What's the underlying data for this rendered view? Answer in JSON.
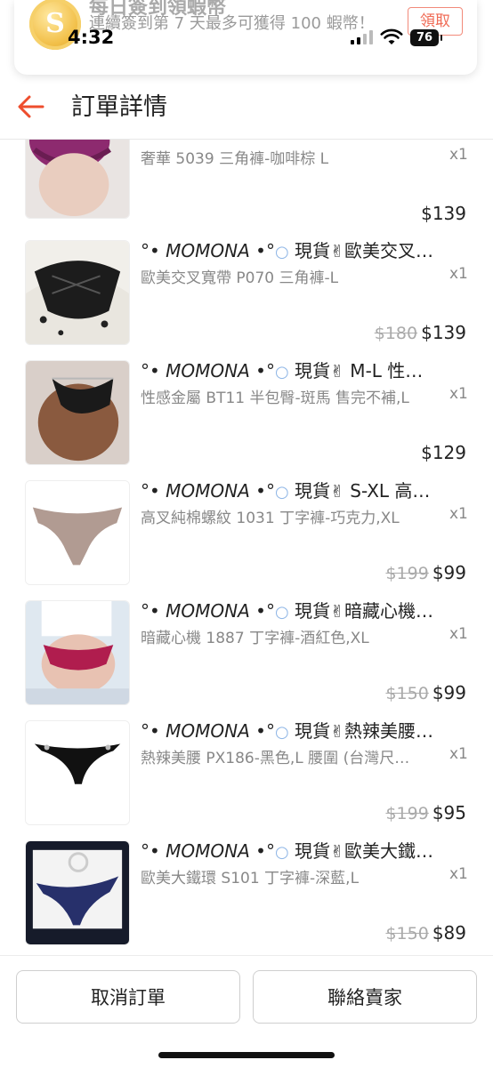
{
  "status_bar": {
    "time": "4:32",
    "battery": "76"
  },
  "banner": {
    "title": "每日簽到領蝦幣",
    "text": "連續簽到第 7 天最多可獲得 100 蝦幣！",
    "claim_label": "領取",
    "coin_letter": "S"
  },
  "header": {
    "title": "訂單詳情"
  },
  "items": [
    {
      "title": "",
      "variant": "奢華 5039 三角褲-咖啡棕 L",
      "qty": "x1",
      "orig_price": "",
      "price": "$139"
    },
    {
      "title_prefix": "°•",
      "brand": "MOMONA",
      "title_mid": "•°",
      "title_tail": "現貨",
      "title_end": "歐美交叉…",
      "variant": "歐美交叉寬帶 P070 三角褲-L",
      "qty": "x1",
      "orig_price": "$180",
      "price": "$139"
    },
    {
      "title_prefix": "°•",
      "brand": "MOMONA",
      "title_mid": "•°",
      "title_tail": "現貨",
      "title_end": " M-L 性…",
      "variant": "性感金屬 BT11 半包臀-斑馬 售完不補,L",
      "qty": "x1",
      "orig_price": "",
      "price": "$129"
    },
    {
      "title_prefix": "°•",
      "brand": "MOMONA",
      "title_mid": "•°",
      "title_tail": "現貨",
      "title_end": " S-XL 高…",
      "variant": "高叉純棉螺紋 1031 丁字褲-巧克力,XL",
      "qty": "x1",
      "orig_price": "$199",
      "price": "$99"
    },
    {
      "title_prefix": "°•",
      "brand": "MOMONA",
      "title_mid": "•°",
      "title_tail": "現貨",
      "title_end": "暗藏心機…",
      "variant": "暗藏心機 1887 丁字褲-酒紅色,XL",
      "qty": "x1",
      "orig_price": "$150",
      "price": "$99"
    },
    {
      "title_prefix": "°•",
      "brand": "MOMONA",
      "title_mid": "•°",
      "title_tail": "現貨",
      "title_end": "熱辣美腰…",
      "variant": "熱辣美腰 PX186-黑色,L 腰圍 (台灣尺…",
      "qty": "x1",
      "orig_price": "$199",
      "price": "$95"
    },
    {
      "title_prefix": "°•",
      "brand": "MOMONA",
      "title_mid": "•°",
      "title_tail": "現貨",
      "title_end": "歐美大鐵…",
      "variant": "歐美大鐵環 S101 丁字褲-深藍,L",
      "qty": "x1",
      "orig_price": "$150",
      "price": "$89"
    }
  ],
  "actions": {
    "cancel_label": "取消訂單",
    "contact_label": "聯絡賣家"
  },
  "colors": {
    "accent": "#ee4d2d",
    "text": "#222222",
    "muted": "#888888"
  }
}
